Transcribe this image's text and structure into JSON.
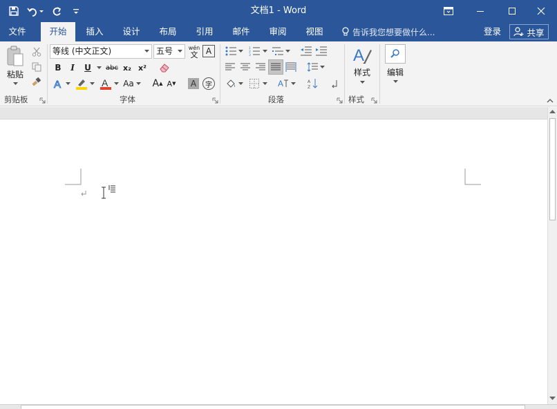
{
  "window": {
    "title": "文档1 - Word"
  },
  "colors": {
    "accent": "#2b579a",
    "ribbon_bg": "#f3f3f3",
    "font_color_bar": "#e0442a",
    "highlight_bar": "#ffd400"
  },
  "tabs": [
    {
      "label": "文件"
    },
    {
      "label": "开始"
    },
    {
      "label": "插入"
    },
    {
      "label": "设计"
    },
    {
      "label": "布局"
    },
    {
      "label": "引用"
    },
    {
      "label": "邮件"
    },
    {
      "label": "审阅"
    },
    {
      "label": "视图"
    }
  ],
  "tell_me": "告诉我您想要做什么...",
  "account": {
    "login": "登录",
    "share": "共享"
  },
  "ribbon": {
    "clipboard": {
      "label": "剪贴板",
      "paste": "粘贴"
    },
    "font": {
      "label": "字体",
      "font_name": "等线 (中文正文)",
      "font_size": "五号",
      "bold": "B",
      "italic": "I",
      "underline": "U",
      "strike": "abc",
      "subscript": "x₂",
      "superscript": "x²",
      "change_case": "Aa",
      "grow": "A",
      "shrink": "A",
      "char_border": "A",
      "enclose": "字",
      "phonetic_top": "wén",
      "phonetic_bottom": "文"
    },
    "paragraph": {
      "label": "段落"
    },
    "styles": {
      "label": "样式",
      "button": "样式"
    },
    "editing": {
      "button": "编辑"
    }
  }
}
